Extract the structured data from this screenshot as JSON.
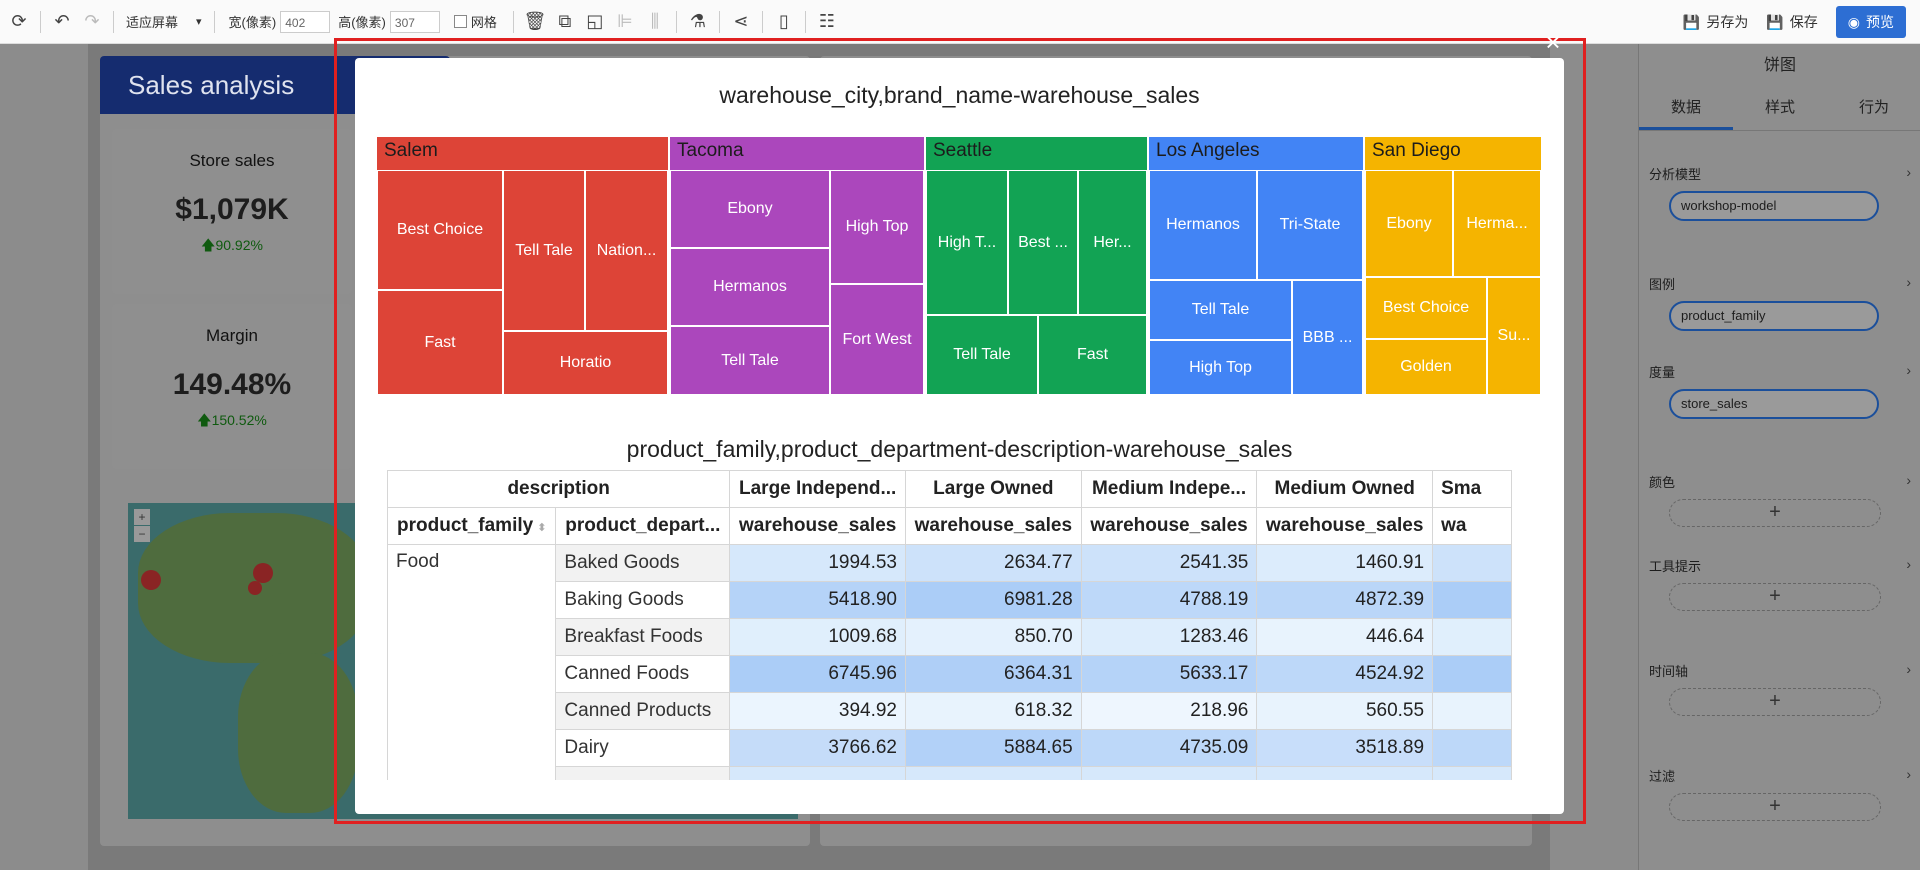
{
  "toolbar": {
    "fit_label": "适应屏幕",
    "width_label": "宽(像素)",
    "width_value": "402",
    "height_label": "高(像素)",
    "height_value": "307",
    "grid_label": "网格",
    "save_as_label": "另存为",
    "save_label": "保存",
    "preview_label": "预览"
  },
  "dashboard": {
    "title": "Sales analysis",
    "kpis": [
      {
        "title": "Store sales",
        "value": "$1,079K",
        "change": "90.92%"
      },
      {
        "title": "Margin",
        "value": "149.48%",
        "change": "150.52%"
      }
    ]
  },
  "panel": {
    "title": "饼图",
    "tabs": [
      "数据",
      "样式",
      "行为"
    ],
    "sections": [
      {
        "label": "分析模型",
        "value": "workshop-model"
      },
      {
        "label": "图例",
        "value": "product_family"
      },
      {
        "label": "度量",
        "value": "store_sales"
      },
      {
        "label": "颜色",
        "value": "+"
      },
      {
        "label": "工具提示",
        "value": "+"
      },
      {
        "label": "时间轴",
        "value": "+"
      },
      {
        "label": "过滤",
        "value": "+"
      }
    ]
  },
  "modal": {
    "close_label": "×",
    "treemap_title": "warehouse_city,brand_name-warehouse_sales",
    "table_title": "product_family,product_department-description-warehouse_sales"
  },
  "treemap": {
    "groups": [
      {
        "name": "Salem",
        "color": "#dd4437",
        "tiles": [
          "Best Choice",
          "Tell Tale",
          "Nation...",
          "Fast",
          "Horatio"
        ]
      },
      {
        "name": "Tacoma",
        "color": "#ab47bc",
        "tiles": [
          "Ebony",
          "High Top",
          "Hermanos",
          "Tell Tale",
          "Fort West"
        ]
      },
      {
        "name": "Seattle",
        "color": "#12a354",
        "tiles": [
          "High T...",
          "Best ...",
          "Her...",
          "Tell Tale",
          "Fast"
        ]
      },
      {
        "name": "Los Angeles",
        "color": "#4284f5",
        "tiles": [
          "Hermanos",
          "Tri-State",
          "Tell Tale",
          "High Top",
          "BBB ..."
        ]
      },
      {
        "name": "San Diego",
        "color": "#f5b400",
        "tiles": [
          "Ebony",
          "Herma...",
          "Best Choice",
          "Golden",
          "Su..."
        ]
      }
    ]
  },
  "table": {
    "description_header": "description",
    "row_headers": [
      "product_family",
      "product_depart..."
    ],
    "columns": [
      "Large Independ...",
      "Large Owned",
      "Medium Indepe...",
      "Medium Owned",
      "Sma"
    ],
    "measure": "warehouse_sales",
    "measure_cut": "wa",
    "family": "Food",
    "rows": [
      {
        "dept": "Baked Goods",
        "values": [
          "1994.53",
          "2634.77",
          "2541.35",
          "1460.91"
        ]
      },
      {
        "dept": "Baking Goods",
        "values": [
          "5418.90",
          "6981.28",
          "4788.19",
          "4872.39"
        ]
      },
      {
        "dept": "Breakfast Foods",
        "values": [
          "1009.68",
          "850.70",
          "1283.46",
          "446.64"
        ]
      },
      {
        "dept": "Canned Foods",
        "values": [
          "6745.96",
          "6364.31",
          "5633.17",
          "4524.92"
        ]
      },
      {
        "dept": "Canned Products",
        "values": [
          "394.92",
          "618.32",
          "218.96",
          "560.55"
        ]
      },
      {
        "dept": "Dairy",
        "values": [
          "3766.62",
          "5884.65",
          "4735.09",
          "3518.89"
        ]
      }
    ]
  }
}
